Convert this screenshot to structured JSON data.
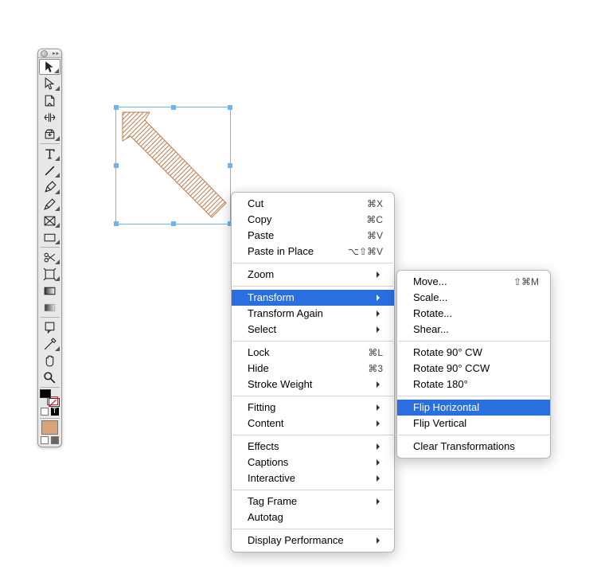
{
  "tools": {
    "items": [
      {
        "name": "selection-tool",
        "label": "Selection"
      },
      {
        "name": "direct-selection-tool",
        "label": "Direct Selection"
      },
      {
        "name": "page-tool",
        "label": "Page"
      },
      {
        "name": "gap-tool",
        "label": "Gap"
      },
      {
        "name": "content-collector-tool",
        "label": "Content Collector"
      },
      {
        "name": "type-tool",
        "label": "Type"
      },
      {
        "name": "line-tool",
        "label": "Line"
      },
      {
        "name": "pen-tool",
        "label": "Pen"
      },
      {
        "name": "pencil-tool",
        "label": "Pencil"
      },
      {
        "name": "rectangle-frame-tool",
        "label": "Rectangle Frame"
      },
      {
        "name": "rectangle-tool",
        "label": "Rectangle"
      },
      {
        "name": "scissors-tool",
        "label": "Scissors"
      },
      {
        "name": "free-transform-tool",
        "label": "Free Transform"
      },
      {
        "name": "gradient-swatch-tool",
        "label": "Gradient Swatch"
      },
      {
        "name": "gradient-feather-tool",
        "label": "Gradient Feather"
      },
      {
        "name": "note-tool",
        "label": "Note"
      },
      {
        "name": "eyedropper-tool",
        "label": "Eyedropper"
      },
      {
        "name": "hand-tool",
        "label": "Hand"
      },
      {
        "name": "zoom-tool",
        "label": "Zoom"
      }
    ]
  },
  "swatch": {
    "fill": "#d9a37a",
    "stroke": "#ffffff",
    "red_x": "#d22"
  },
  "context_menu": {
    "cut": {
      "label": "Cut",
      "shortcut": "⌘X"
    },
    "copy": {
      "label": "Copy",
      "shortcut": "⌘C"
    },
    "paste": {
      "label": "Paste",
      "shortcut": "⌘V"
    },
    "paste_in_place": {
      "label": "Paste in Place",
      "shortcut": "⌥⇧⌘V"
    },
    "zoom": {
      "label": "Zoom"
    },
    "transform": {
      "label": "Transform"
    },
    "transform_again": {
      "label": "Transform Again"
    },
    "select": {
      "label": "Select"
    },
    "lock": {
      "label": "Lock",
      "shortcut": "⌘L"
    },
    "hide": {
      "label": "Hide",
      "shortcut": "⌘3"
    },
    "stroke_weight": {
      "label": "Stroke Weight"
    },
    "fitting": {
      "label": "Fitting"
    },
    "content": {
      "label": "Content"
    },
    "effects": {
      "label": "Effects"
    },
    "captions": {
      "label": "Captions"
    },
    "interactive": {
      "label": "Interactive"
    },
    "tag_frame": {
      "label": "Tag Frame"
    },
    "autotag": {
      "label": "Autotag"
    },
    "display_perf": {
      "label": "Display Performance"
    }
  },
  "transform_submenu": {
    "move": {
      "label": "Move...",
      "shortcut": "⇧⌘M"
    },
    "scale": {
      "label": "Scale..."
    },
    "rotate": {
      "label": "Rotate..."
    },
    "shear": {
      "label": "Shear..."
    },
    "rot90cw": {
      "label": "Rotate 90° CW"
    },
    "rot90ccw": {
      "label": "Rotate 90° CCW"
    },
    "rot180": {
      "label": "Rotate 180°"
    },
    "fliph": {
      "label": "Flip Horizontal"
    },
    "flipv": {
      "label": "Flip Vertical"
    },
    "clear": {
      "label": "Clear Transformations"
    }
  }
}
